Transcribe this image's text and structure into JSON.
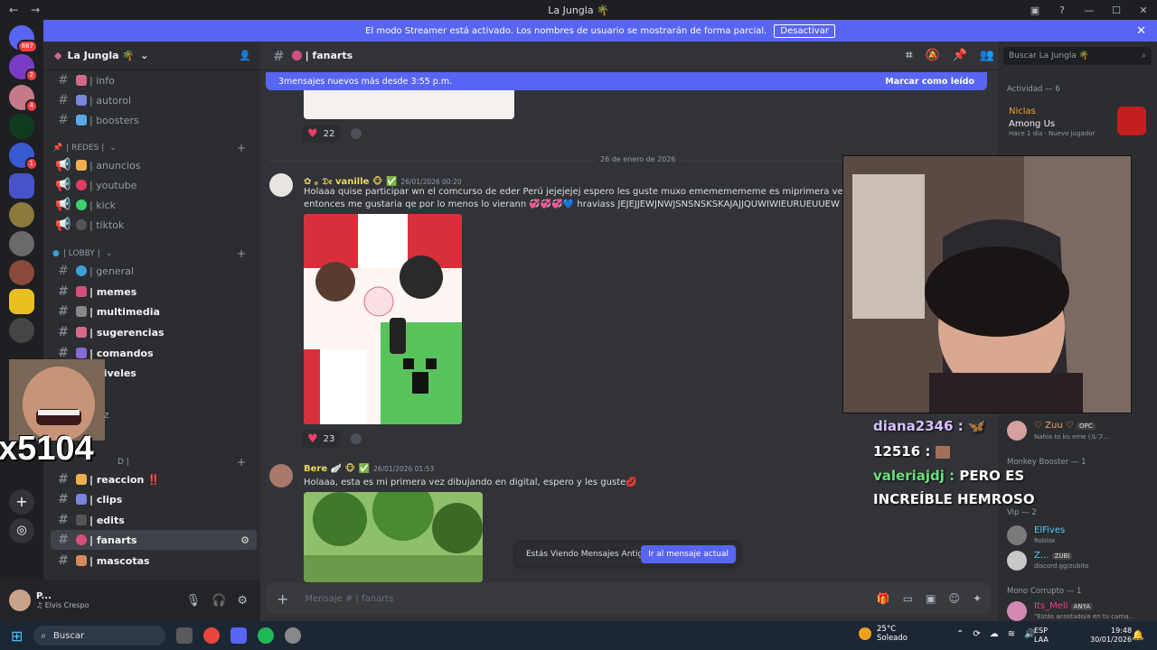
{
  "window": {
    "title": "La Jungla 🌴"
  },
  "streamer_banner": {
    "text": "El modo Streamer está activado. Los nombres de usuario se mostrarán de forma parcial.",
    "button": "Desactivar"
  },
  "guilds": [
    {
      "badge": "887"
    },
    {
      "badge": "2"
    },
    {
      "badge": "4"
    },
    {
      "badge": ""
    },
    {
      "badge": "1"
    }
  ],
  "server": {
    "name": "La Jungla 🌴"
  },
  "channels_top": [
    {
      "name": "| info",
      "color": "#d46a8a"
    },
    {
      "name": "| autorol",
      "color": "#7a86d9"
    },
    {
      "name": "| boosters",
      "color": "#5aa8e6"
    }
  ],
  "cat_redes": {
    "label": "| REDES |"
  },
  "channels_redes": [
    {
      "name": "| anuncios",
      "color": "#f0b050"
    },
    {
      "name": "| youtube",
      "color": "#e03c64"
    },
    {
      "name": "| kick",
      "color": "#3bd16f"
    },
    {
      "name": "| tiktok",
      "color": "#555"
    }
  ],
  "cat_lobby": {
    "label": "| LOBBY |"
  },
  "channels_lobby": [
    {
      "name": "| general",
      "color": "#3aa0d8"
    },
    {
      "name": "| memes",
      "color": "#d4507a"
    },
    {
      "name": "| multimedia",
      "color": "#888"
    },
    {
      "name": "| sugerencias",
      "color": "#d46a8a"
    },
    {
      "name": "| comandos",
      "color": "#8a6ad4"
    },
    {
      "name": "| niveles",
      "color": "#d4b04a"
    }
  ],
  "partial_channel": {
    "name": "oz"
  },
  "cat_extra": {
    "label": "D |"
  },
  "channels_extra": [
    {
      "name": "| reaccion ‼️",
      "color": "#f0b050"
    },
    {
      "name": "| clips",
      "color": "#7a86d9"
    },
    {
      "name": "| edits",
      "color": "#555"
    },
    {
      "name": "| fanarts",
      "color": "#d4507a"
    },
    {
      "name": "| mascotas",
      "color": "#d48a5a"
    }
  ],
  "user": {
    "name": "P...",
    "status": "♫ Elvis Crespo"
  },
  "channel": {
    "name": "| fanarts"
  },
  "new_messages": {
    "text": "3mensajes nuevos más desde 3:55 p.m.",
    "action": "Marcar como leído"
  },
  "reactions": {
    "first": "22",
    "second": "23"
  },
  "date_divider": "26 de enero de 2026",
  "message1": {
    "author": "✿ ｡ 𝔇𝔢 vanille 🐵 ✅",
    "time": "26/01/2026 00:20",
    "line1": "Holaaa quise participar wn el comcurso de eder Perú jejejejej espero les guste muxo emememememe  es miprimera vez participando",
    "line2": "entonces me gustaria qe por lo menos lo vierann 💞💞💞💙 hraviass JEJEJJEWJNWJSNSNSKSKAJAJJQUWIWIEURUEUUEW",
    "art_text": "Perú"
  },
  "message2": {
    "author": "Bere 🪽 🐵 ✅",
    "time": "26/01/2026 01:53",
    "line1": "Holaaa, esta es mi primera vez dibujando en digital, espero y les guste💋"
  },
  "old_messages": {
    "text": "Estás Viendo Mensajes Antiguos",
    "button": "Ir al mensaje actual"
  },
  "composer": {
    "placeholder": "Mensaje # | fanarts"
  },
  "search": {
    "placeholder": "Buscar La Jungla 🌴"
  },
  "activity": {
    "label": "Actividad — 6",
    "user": "Niclas",
    "game": "Among Us",
    "meta": "Hace 1 día",
    "tag": "Nuevo jugador"
  },
  "members": [
    {
      "name": "♡ Zuu ♡",
      "tag": "OPC",
      "sub": "Nahia to ku eme (ルフ..."
    },
    {
      "group": "Monkey Booster — 1"
    },
    {
      "group": "Vip — 2"
    },
    {
      "name": "ElFives",
      "sub": "Roblox"
    },
    {
      "name": "Z...",
      "tag": "ZUBI",
      "sub": "discord.gg/zubito"
    },
    {
      "group": "Mono Corrupto — 1"
    },
    {
      "name": "Its_Mell",
      "tag": "ANYA",
      "sub": "\"Estás acostado/a en tu cama..."
    }
  ],
  "stream_chat": [
    {
      "user": "diana2346 :",
      "msg": "🦋"
    },
    {
      "user": "12516 :",
      "msg": ""
    },
    {
      "user": "valeriajdj :",
      "msg": "PERO ES INCREÍBLE HEMROSO"
    }
  ],
  "overlay_counter": "x5104",
  "taskbar": {
    "search": "Buscar",
    "temp": "25°C",
    "weather": "Soleado",
    "lang1": "ESP",
    "lang2": "LAA",
    "time": "19:48",
    "date": "30/01/2026"
  },
  "colors": {
    "accent": "#5865f2",
    "bg": "#313338",
    "sidebar": "#2b2d31"
  }
}
